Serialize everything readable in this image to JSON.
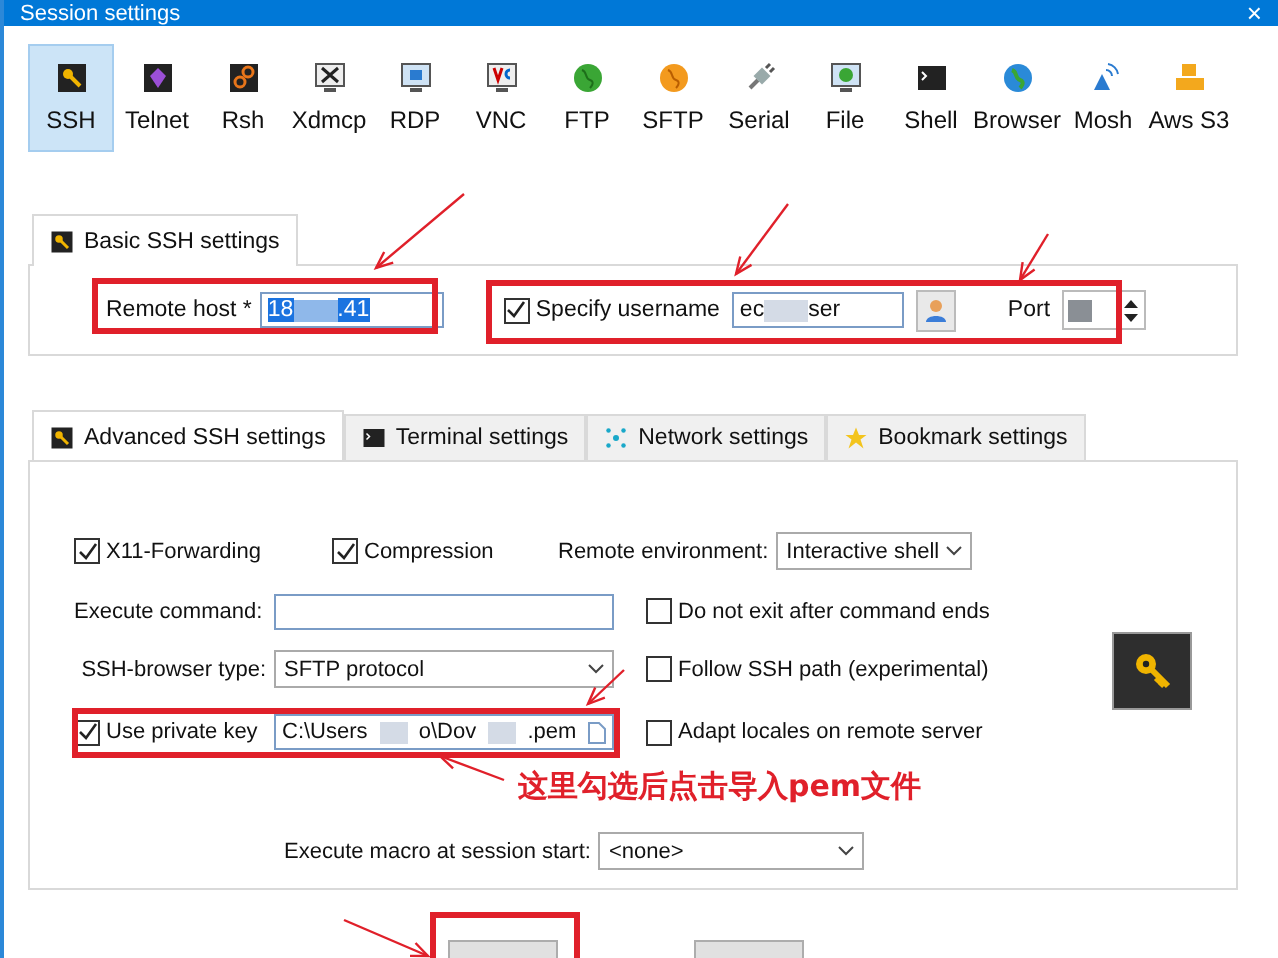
{
  "window": {
    "title": "Session settings",
    "close": "×"
  },
  "session_types": [
    {
      "label": "SSH",
      "kind": "key",
      "selected": true
    },
    {
      "label": "Telnet",
      "kind": "gem",
      "selected": false
    },
    {
      "label": "Rsh",
      "kind": "gears",
      "selected": false
    },
    {
      "label": "Xdmcp",
      "kind": "xmonitor",
      "selected": false
    },
    {
      "label": "RDP",
      "kind": "monitor",
      "selected": false
    },
    {
      "label": "VNC",
      "kind": "vmonitor",
      "selected": false
    },
    {
      "label": "FTP",
      "kind": "greenglobe",
      "selected": false
    },
    {
      "label": "SFTP",
      "kind": "orangeglobe",
      "selected": false
    },
    {
      "label": "Serial",
      "kind": "plug",
      "selected": false
    },
    {
      "label": "File",
      "kind": "globemonitor",
      "selected": false
    },
    {
      "label": "Shell",
      "kind": "terminal",
      "selected": false
    },
    {
      "label": "Browser",
      "kind": "blueglobe",
      "selected": false
    },
    {
      "label": "Mosh",
      "kind": "antenna",
      "selected": false
    },
    {
      "label": "Aws S3",
      "kind": "boxes",
      "selected": false
    }
  ],
  "basic_tab": {
    "label": "Basic SSH settings",
    "selected": true
  },
  "remote_host": {
    "label": "Remote host *",
    "value_parts": [
      "18",
      ".41"
    ]
  },
  "username": {
    "checked": true,
    "label": "Specify username",
    "value_parts": [
      "ec",
      "ser"
    ]
  },
  "port": {
    "label": "Port"
  },
  "advanced_tabs": [
    {
      "label": "Advanced SSH settings",
      "kind": "key",
      "selected": true
    },
    {
      "label": "Terminal settings",
      "kind": "terminal",
      "selected": false
    },
    {
      "label": "Network settings",
      "kind": "network",
      "selected": false
    },
    {
      "label": "Bookmark settings",
      "kind": "star",
      "selected": false
    }
  ],
  "x11_forwarding": {
    "label": "X11-Forwarding",
    "checked": true
  },
  "compression": {
    "label": "Compression",
    "checked": true
  },
  "remote_environment": {
    "label": "Remote environment:",
    "value": "Interactive shell"
  },
  "execute_command": {
    "label": "Execute command:"
  },
  "do_not_exit": {
    "label": "Do not exit after command ends",
    "checked": false
  },
  "ssh_browser_type": {
    "label": "SSH-browser type:",
    "value": "SFTP protocol"
  },
  "follow_ssh_path": {
    "label": "Follow SSH path (experimental)",
    "checked": false
  },
  "private_key": {
    "label": "Use private key",
    "checked": true,
    "value_parts": [
      "C:\\Users",
      "o\\Dov",
      ".pem"
    ]
  },
  "adapt_locales": {
    "label": "Adapt locales on remote server",
    "checked": false
  },
  "execute_macro": {
    "label": "Execute macro at session start:",
    "value": "<none>"
  },
  "annotation": {
    "text": "这里勾选后点击导入pem文件"
  }
}
